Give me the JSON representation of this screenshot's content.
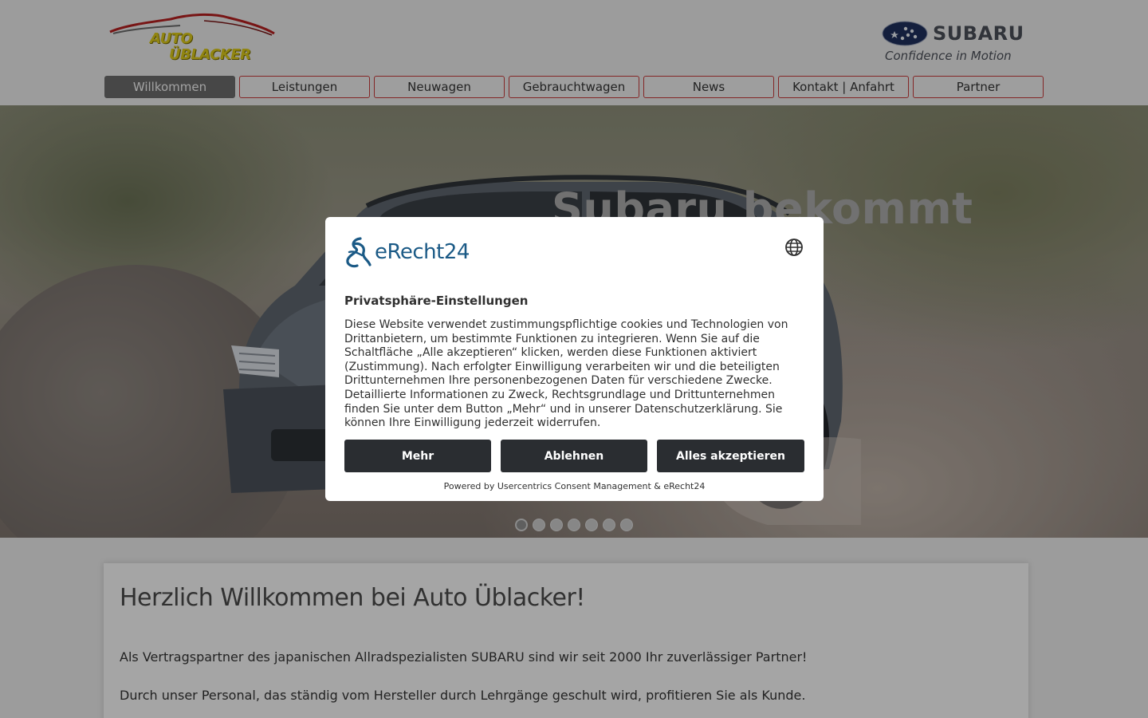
{
  "header": {
    "logo_left": {
      "line1": "AUTO",
      "line2": "ÜBLACKER"
    },
    "logo_right": {
      "brand": "SUBARU",
      "tagline": "Confidence in Motion"
    }
  },
  "nav": {
    "items": [
      {
        "label": "Willkommen",
        "active": true
      },
      {
        "label": "Leistungen",
        "active": false
      },
      {
        "label": "Neuwagen",
        "active": false
      },
      {
        "label": "Gebrauchtwagen",
        "active": false
      },
      {
        "label": "News",
        "active": false
      },
      {
        "label": "Kontakt | Anfahrt",
        "active": false
      },
      {
        "label": "Partner",
        "active": false
      }
    ]
  },
  "hero": {
    "title": "Subaru bekommt Zuwachs",
    "title_mark": "*",
    "slides_total": 7,
    "active_slide": 1
  },
  "content": {
    "heading": "Herzlich Willkommen bei Auto Üblacker!",
    "paragraph1": "Als Vertragspartner des japanischen Allradspezialisten SUBARU sind wir seit 2000 Ihr zuverlässiger Partner!",
    "paragraph2": "Durch unser Personal, das ständig vom Hersteller durch Lehrgänge geschult wird, profitieren Sie als Kunde."
  },
  "consent": {
    "brand": "eRecht24",
    "title": "Privatsphäre-Einstellungen",
    "body": "Diese Website verwendet zustimmungspflichtige cookies und Technologien von Drittanbietern, um bestimmte Funktionen zu integrieren. Wenn Sie auf die Schaltfläche „Alle akzeptieren“ klicken, werden diese Funktionen aktiviert (Zustimmung). Nach erfolgter Einwilligung verarbeiten wir und die beteiligten Drittunternehmen Ihre personenbezogenen Daten für verschiedene Zwecke. Detaillierte Informationen zu Zweck, Rechtsgrundlage und Drittunternehmen finden Sie unter dem Button „Mehr“ und in unserer Datenschutzerklärung. Sie können Ihre Einwilligung jederzeit widerrufen.",
    "btn_more": "Mehr",
    "btn_reject": "Ablehnen",
    "btn_accept": "Alles akzeptieren",
    "powered_by": "Powered by Usercentrics Consent Management & eRecht24"
  },
  "colors": {
    "nav_border": "#c43a3a",
    "nav_active_bg": "#6a6a6a",
    "button_bg": "#2a2d31",
    "erecht_blue": "#1b5a86"
  },
  "icons": [
    "car-silhouette-logo",
    "subaru-emblem",
    "globe-icon",
    "erecht24-logo-mark"
  ]
}
